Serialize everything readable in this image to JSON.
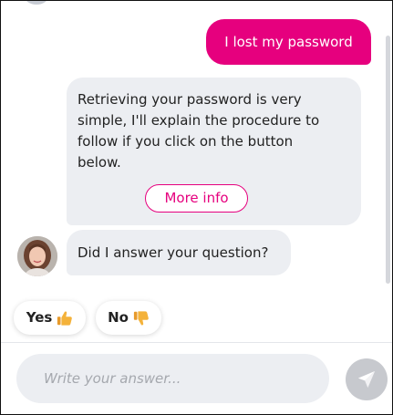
{
  "colors": {
    "accent": "#e6007e",
    "bubble_bg": "#eceef2",
    "send_button": "#c7c9ce",
    "thumb": "#f4b23a"
  },
  "conversation": {
    "user_message": "I lost my password",
    "bot_message_lines": [
      "Retrieving your password is very",
      "simple, I'll explain the procedure to",
      "follow if you click on the button",
      "below."
    ],
    "more_info_label": "More info",
    "bot_question": "Did I answer your question?"
  },
  "quick_replies": [
    {
      "label": "Yes",
      "icon": "thumbs-up-icon"
    },
    {
      "label": "No",
      "icon": "thumbs-down-icon"
    }
  ],
  "composer": {
    "placeholder": "Write your answer...",
    "value": "",
    "send_icon": "paper-plane-icon"
  },
  "avatar": {
    "icon": "agent-avatar"
  }
}
